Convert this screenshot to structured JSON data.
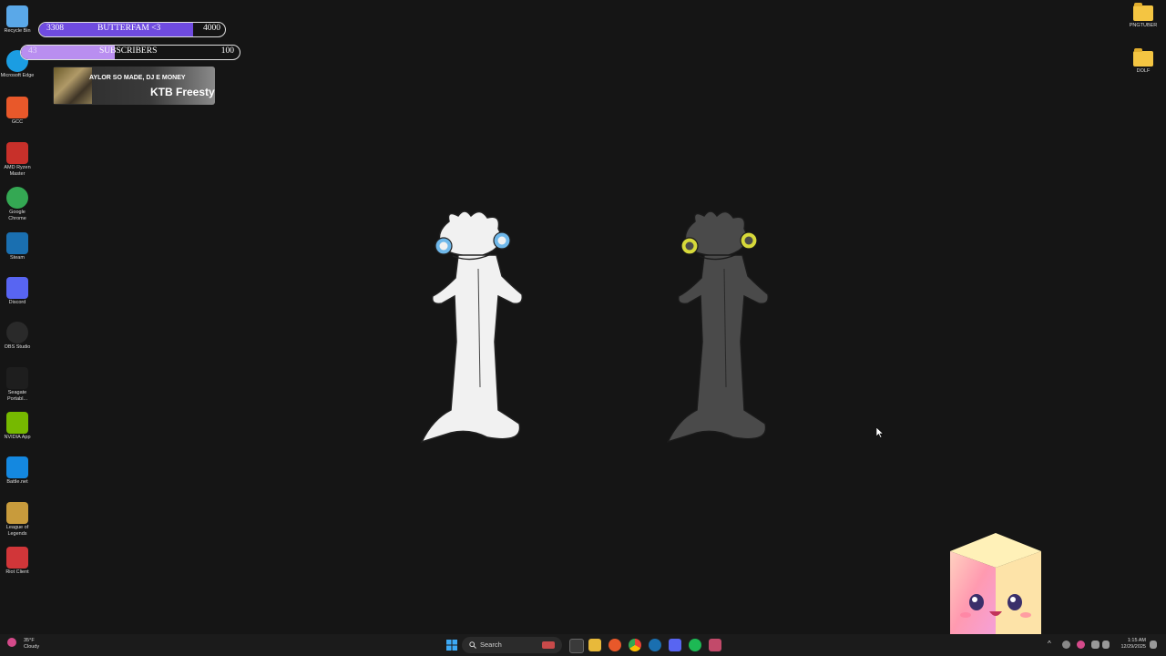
{
  "desktop_left": [
    {
      "label": "Recycle Bin",
      "icon": "recycle-bin-icon",
      "color": "#5aa8e8"
    },
    {
      "label": "Microsoft Edge",
      "icon": "edge-icon",
      "color": "#1b9de2"
    },
    {
      "label": "GCC",
      "icon": "gcc-icon",
      "color": "#e8582a"
    },
    {
      "label": "AMD Ryzen Master",
      "icon": "amd-ryzen-icon",
      "color": "#c8302a"
    },
    {
      "label": "Google Chrome",
      "icon": "chrome-icon",
      "color": "#34a853"
    },
    {
      "label": "Steam",
      "icon": "steam-icon",
      "color": "#1a6fb0"
    },
    {
      "label": "Discord",
      "icon": "discord-icon",
      "color": "#5865f2"
    },
    {
      "label": "OBS Studio",
      "icon": "obs-icon",
      "color": "#2a2a2a"
    },
    {
      "label": "Seagate Portabl...",
      "icon": "seagate-icon",
      "color": "#1e1e1e"
    },
    {
      "label": "NVIDIA App",
      "icon": "nvidia-icon",
      "color": "#76b900"
    },
    {
      "label": "Battle.net",
      "icon": "battlenet-icon",
      "color": "#1488e0"
    },
    {
      "label": "League of Legends",
      "icon": "league-icon",
      "color": "#c89b3c"
    },
    {
      "label": "Riot Client",
      "icon": "riot-icon",
      "color": "#d13639"
    }
  ],
  "desktop_right": [
    {
      "label": "PNGTUBER",
      "icon": "folder-icon"
    },
    {
      "label": "DOLF",
      "icon": "folder-icon"
    }
  ],
  "goal_butterfam": {
    "current": "3308",
    "label": "BUTTERFAM <3",
    "target": "4000",
    "progress": 0.827,
    "color": "#6f4be0"
  },
  "goal_subscribers": {
    "current": "43",
    "label": "SUBSCRIBERS",
    "target": "100",
    "progress": 0.43,
    "color": "#b98ef0"
  },
  "now_playing": {
    "artist": "AYLOR SO MADE, DJ E MONEY",
    "title": "KTB Freesty"
  },
  "characters": [
    {
      "name": "white-dancing-salamander",
      "body_color": "#f1f1f1",
      "eye_color": "#6fb8ea"
    },
    {
      "name": "dark-dancing-salamander",
      "body_color": "#4a4a4a",
      "eye_color": "#d7d93a"
    }
  ],
  "taskbar": {
    "weather_temp": "35°F",
    "weather_cond": "Cloudy",
    "search_placeholder": "Search",
    "time": "1:15 AM",
    "date": "12/29/2025"
  }
}
